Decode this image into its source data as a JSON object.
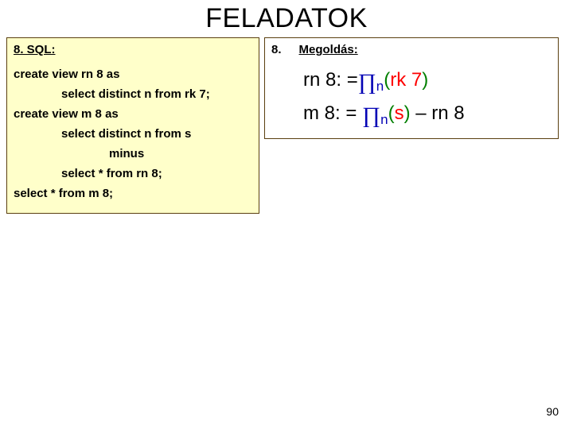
{
  "title": "FELADATOK",
  "left": {
    "header": "8. SQL:",
    "l1": "create view rn 8 as",
    "l2": "select distinct n from rk 7;",
    "l3": "create view m 8 as",
    "l4": "select distinct n from s",
    "l5": "minus",
    "l6": "select * from rn 8;",
    "l7": "select * from m 8;"
  },
  "right": {
    "num": "8.",
    "header": "Megoldás:",
    "f1_a": "rn 8: =",
    "f1_sub": "n",
    "f1_b": "(",
    "f1_arg": "rk 7",
    "f1_c": ")",
    "f2_a": "m 8: = ",
    "f2_sub": "n",
    "f2_b": "(",
    "f2_arg": "s",
    "f2_c": ")",
    "f2_d": " – rn 8"
  },
  "slideno": "90"
}
